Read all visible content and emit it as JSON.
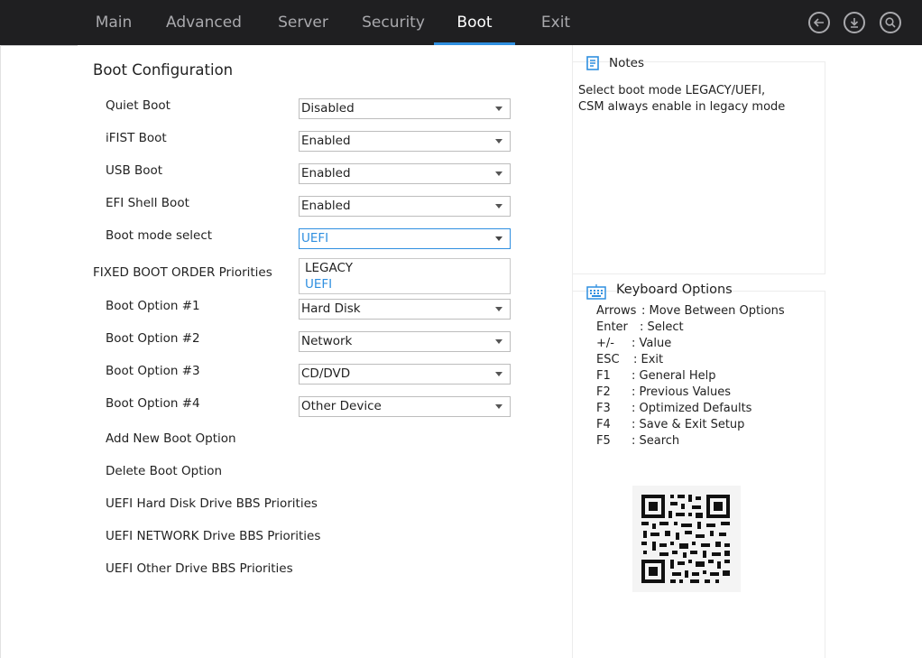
{
  "nav": {
    "tabs": [
      {
        "label": "Main"
      },
      {
        "label": "Advanced"
      },
      {
        "label": "Server"
      },
      {
        "label": "Security"
      },
      {
        "label": "Boot"
      },
      {
        "label": "Exit"
      }
    ],
    "active_tab": "Boot",
    "icons": [
      "back-icon",
      "download-icon",
      "search-icon"
    ]
  },
  "boot": {
    "section_title": "Boot Configuration",
    "settings": [
      {
        "label": "Quiet Boot",
        "value": "Disabled"
      },
      {
        "label": "iFIST Boot",
        "value": "Enabled"
      },
      {
        "label": "USB Boot",
        "value": "Enabled"
      },
      {
        "label": "EFI Shell Boot",
        "value": "Enabled"
      },
      {
        "label": "Boot mode select",
        "value": "UEFI"
      }
    ],
    "boot_mode_options": [
      "LEGACY",
      "UEFI"
    ],
    "boot_mode_selected": "UEFI",
    "fixed_order_title": "FIXED BOOT ORDER Priorities",
    "boot_options": [
      {
        "label": "Boot Option #1",
        "value": "Hard Disk"
      },
      {
        "label": "Boot Option #2",
        "value": "Network"
      },
      {
        "label": "Boot Option #3",
        "value": "CD/DVD"
      },
      {
        "label": "Boot Option #4",
        "value": "Other Device"
      }
    ],
    "links": [
      "Add New Boot Option",
      "Delete Boot Option",
      "UEFI Hard Disk Drive BBS Priorities",
      "UEFI NETWORK Drive BBS Priorities",
      "UEFI Other Drive BBS Priorities"
    ]
  },
  "notes": {
    "title": "Notes",
    "lines": [
      "Select boot mode LEGACY/UEFI,",
      "CSM always enable in legacy mode"
    ]
  },
  "keyboard": {
    "title": "Keyboard Options",
    "items": [
      {
        "key": "Arrows",
        "desc": ": Move Between Options"
      },
      {
        "key": "Enter",
        "desc": ": Select"
      },
      {
        "key": "+/-",
        "desc": ": Value"
      },
      {
        "key": "ESC",
        "desc": ": Exit"
      },
      {
        "key": "F1",
        "desc": ": General Help"
      },
      {
        "key": "F2",
        "desc": ": Previous Values"
      },
      {
        "key": "F3",
        "desc": ": Optimized Defaults"
      },
      {
        "key": "F4",
        "desc": ": Save & Exit Setup"
      },
      {
        "key": "F5",
        "desc": ": Search"
      }
    ]
  },
  "colors": {
    "topbar_bg": "#1f1f21",
    "accent": "#2f8fe0",
    "tab_inactive": "#a9a9ad"
  }
}
